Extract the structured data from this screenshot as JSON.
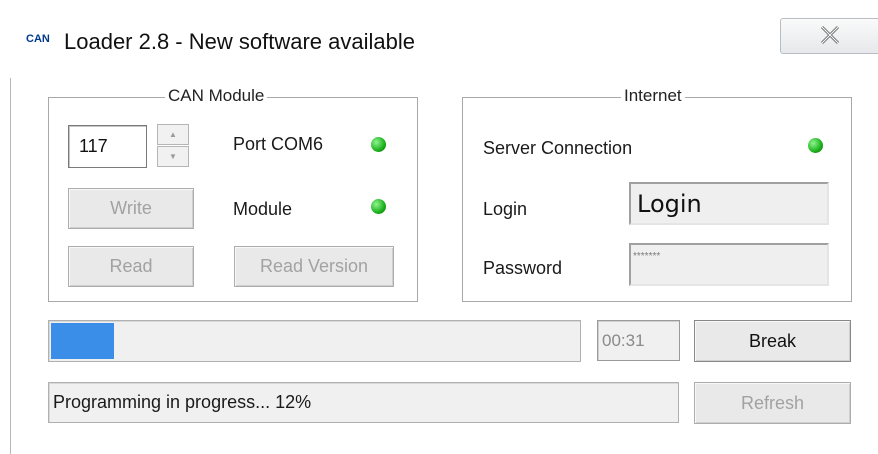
{
  "window": {
    "icon_text": "CAN",
    "title": "Loader 2.8 - New software available"
  },
  "can_module": {
    "legend": "CAN Module",
    "address_value": "117",
    "port_label": "Port COM6",
    "module_label": "Module",
    "write_label": "Write",
    "read_label": "Read",
    "read_version_label": "Read Version",
    "port_status_color": "#1bb01b",
    "module_status_color": "#1bb01b"
  },
  "internet": {
    "legend": "Internet",
    "server_connection_label": "Server Connection",
    "server_status_color": "#1bb01b",
    "login_label": "Login",
    "login_value": "Login",
    "password_label": "Password",
    "password_value": "*******"
  },
  "progress": {
    "percent": 12,
    "fill_color": "#3b8ee8",
    "timer": "00:31",
    "break_label": "Break",
    "status_text": "Programming in progress... 12%",
    "refresh_label": "Refresh"
  }
}
